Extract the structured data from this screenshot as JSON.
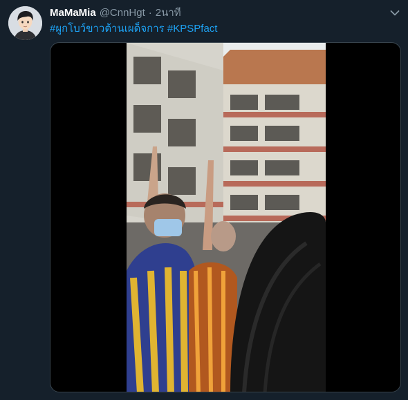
{
  "tweet": {
    "display_name": "MaMaMia",
    "handle": "@CnnHgt",
    "separator": "·",
    "time": "2นาที",
    "hashtags": [
      {
        "text": "#ผูกโบว์ขาวต้านเผด็จการ",
        "selected": false
      },
      {
        "text": "#",
        "selected": false
      },
      {
        "text": "KPSPfact",
        "selected": true
      }
    ],
    "icons": {
      "more": "chevron-down-icon"
    },
    "colors": {
      "background": "#15202b",
      "link": "#1da1f2",
      "selection": "#1a73d9",
      "secondary_text": "#8899a6",
      "border": "#38444d"
    },
    "media": {
      "type": "video"
    }
  }
}
